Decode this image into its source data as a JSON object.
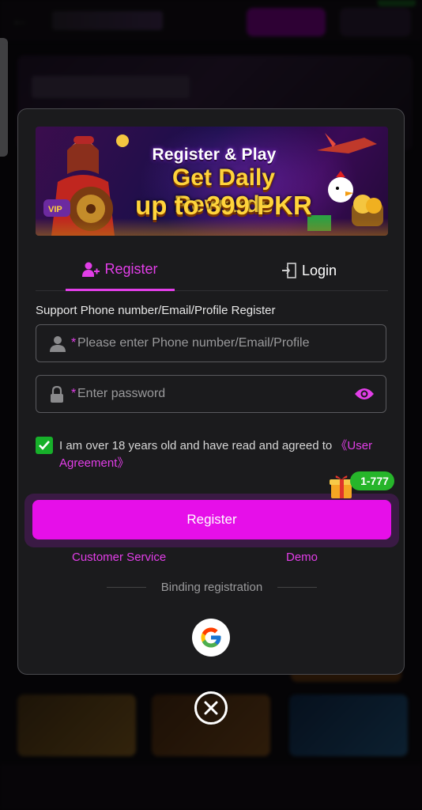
{
  "banner": {
    "title": "Register & Play",
    "subtitle": "Get Daily Rewards",
    "amount": "up to 399 PKR",
    "badge": "VIP"
  },
  "tabs": [
    {
      "label": "Register",
      "icon": "add-user-icon",
      "active": true
    },
    {
      "label": "Login",
      "icon": "login-door-icon",
      "active": false
    }
  ],
  "form": {
    "support_label": "Support Phone number/Email/Profile Register",
    "required_mark": "*",
    "account_placeholder": "Please enter Phone number/Email/Profile",
    "password_placeholder": "Enter password",
    "agreement_checked": true,
    "agreement_text": "I am over 18 years old and have read and agreed to ",
    "agreement_link": "《User Agreement》",
    "register_button": "Register",
    "bonus_badge": "1-777"
  },
  "links": {
    "customer_service": "Customer Service",
    "demo": "Demo"
  },
  "binding": {
    "label": "Binding registration",
    "providers": [
      "google-icon"
    ]
  },
  "colors": {
    "accent": "#e60fe9",
    "check": "#17b02a",
    "modal_bg": "#1b1b1d"
  }
}
